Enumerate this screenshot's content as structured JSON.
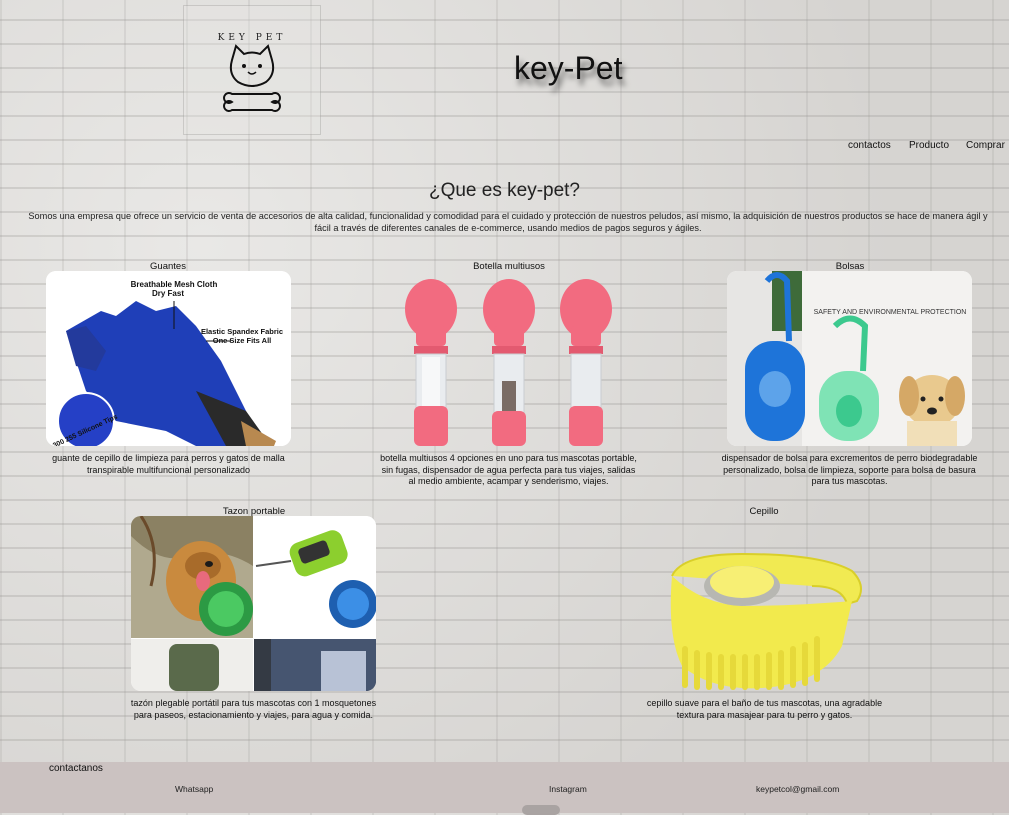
{
  "header": {
    "site_title": "key-Pet",
    "logo_text": "KEY PET"
  },
  "nav": {
    "contactos": "contactos",
    "producto": "Producto",
    "comprar": "Comprar"
  },
  "about": {
    "title": "¿Que es key-pet?",
    "text": "Somos una empresa que ofrece un servicio de venta de accesorios de alta calidad, funcionalidad y comodidad para el cuidado y protección de nuestros peludos, así mismo, la adquisición de nuestros productos se hace de manera ágil y fácil a través de diferentes canales de e-commerce, usando medios de pagos seguros y ágiles."
  },
  "products": [
    {
      "title": "Guantes",
      "image_text": [
        "Breathable Mesh Cloth",
        "Dry Fast",
        "Elastic Spandex Fabric",
        "One Size Fits All",
        "300 255 Silicone Tips"
      ],
      "description": "guante de cepillo de limpieza para perros y gatos de malla transpirable multifuncional personalizado"
    },
    {
      "title": "Botella multiusos",
      "description": "botella multiusos 4 opciones en uno para tus mascotas portable, sin fugas, dispensador de agua perfecta para tus viajes, salidas al medio ambiente, acampar y senderismo, viajes."
    },
    {
      "title": "Bolsas",
      "image_text": [
        "SAFETY AND ENVIRONMENTAL PROTECTION"
      ],
      "description": "dispensador de bolsa para excrementos de perro biodegradable personalizado, bolsa de limpieza, soporte para bolsa de basura para tus mascotas."
    },
    {
      "title": "Tazon portable",
      "description": "tazón plegable portátil para tus mascotas con 1 mosquetones para paseos, estacionamiento y viajes, para agua y comida."
    },
    {
      "title": "Cepillo",
      "description": "cepillo suave para el baño de tus mascotas, una agradable textura para masajear para tu perro y gatos."
    }
  ],
  "footer": {
    "heading": "contactanos",
    "whatsapp": "Whatsapp",
    "instagram": "Instagram",
    "email": "keypetcol@gmail.com"
  }
}
